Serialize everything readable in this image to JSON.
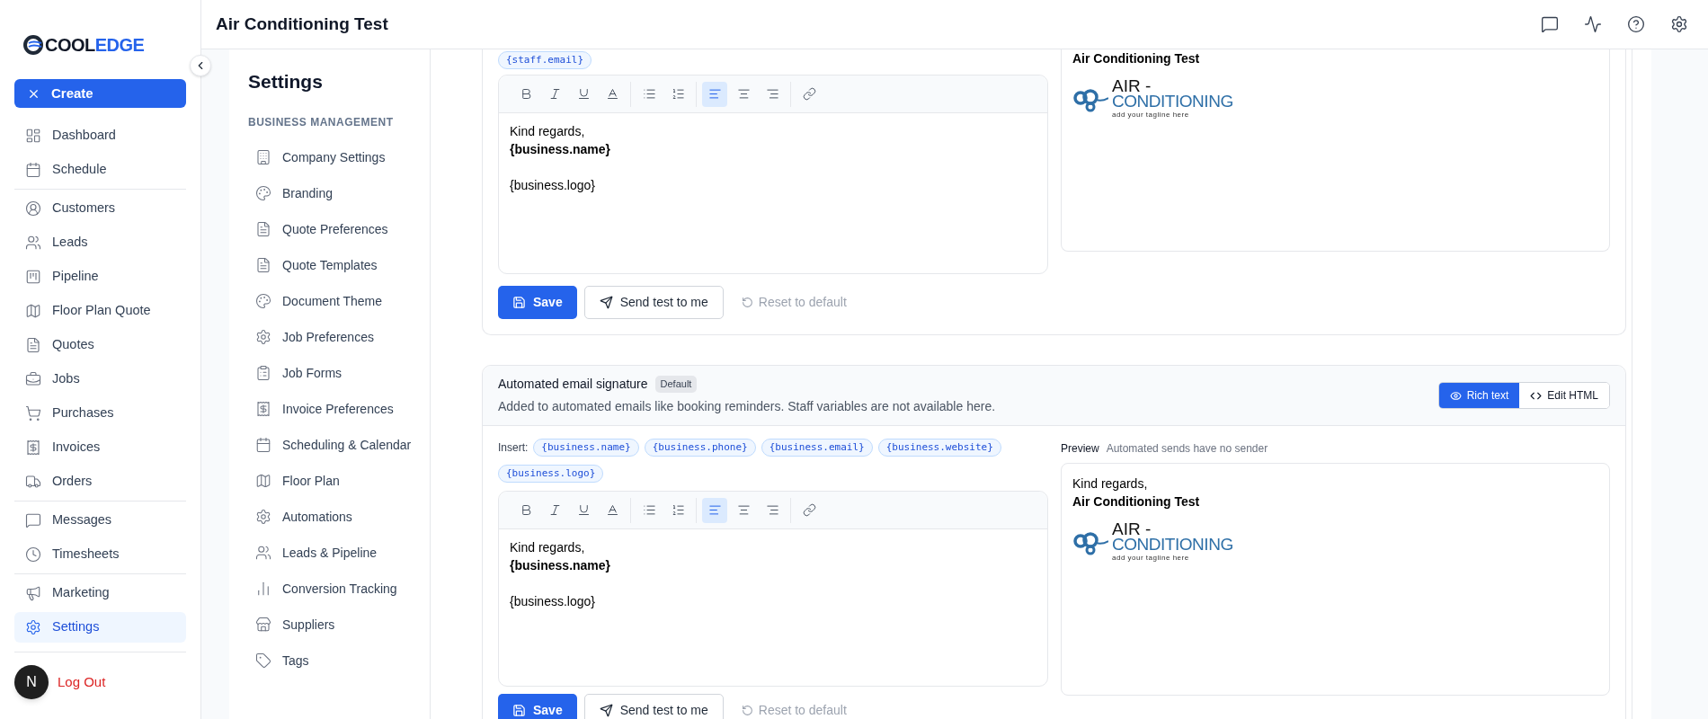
{
  "brand": {
    "part_a": "COOL",
    "part_b": "EDGE"
  },
  "sidebar": {
    "create": "Create",
    "groups": [
      [
        {
          "label": "Dashboard",
          "selected": false
        },
        {
          "label": "Schedule",
          "selected": false
        }
      ],
      [
        {
          "label": "Customers",
          "selected": false
        },
        {
          "label": "Leads",
          "selected": false
        },
        {
          "label": "Pipeline",
          "selected": false
        },
        {
          "label": "Floor Plan Quote",
          "selected": false
        },
        {
          "label": "Quotes",
          "selected": false
        },
        {
          "label": "Jobs",
          "selected": false
        },
        {
          "label": "Purchases",
          "selected": false
        },
        {
          "label": "Invoices",
          "selected": false
        },
        {
          "label": "Orders",
          "selected": false
        }
      ],
      [
        {
          "label": "Messages",
          "selected": false
        },
        {
          "label": "Timesheets",
          "selected": false
        }
      ],
      [
        {
          "label": "Marketing",
          "selected": false
        },
        {
          "label": "Settings",
          "selected": true
        }
      ]
    ],
    "logout": "Log Out",
    "avatar": "N"
  },
  "header": {
    "title": "Air Conditioning Test"
  },
  "settings_nav": {
    "title": "Settings",
    "section": "BUSINESS MANAGEMENT",
    "items": [
      {
        "label": "Company Settings"
      },
      {
        "label": "Branding"
      },
      {
        "label": "Quote Preferences"
      },
      {
        "label": "Quote Templates"
      },
      {
        "label": "Document Theme"
      },
      {
        "label": "Job Preferences"
      },
      {
        "label": "Job Forms"
      },
      {
        "label": "Invoice Preferences"
      },
      {
        "label": "Scheduling & Calendar"
      },
      {
        "label": "Floor Plan"
      },
      {
        "label": "Automations"
      },
      {
        "label": "Leads & Pipeline"
      },
      {
        "label": "Conversion Tracking"
      },
      {
        "label": "Suppliers"
      },
      {
        "label": "Tags"
      }
    ]
  },
  "cards": [
    {
      "chips": [
        "{staff.email}"
      ],
      "toolbar": [
        [
          {
            "kind": "bold",
            "selected": false
          },
          {
            "kind": "italic",
            "selected": false
          },
          {
            "kind": "underline",
            "selected": false
          },
          {
            "kind": "color",
            "selected": false
          }
        ],
        [
          {
            "kind": "bullets",
            "selected": false
          },
          {
            "kind": "numbers",
            "selected": false
          }
        ],
        [
          {
            "kind": "left",
            "selected": true
          },
          {
            "kind": "center",
            "selected": false
          },
          {
            "kind": "right",
            "selected": false
          }
        ],
        [
          {
            "kind": "link",
            "selected": false
          }
        ]
      ],
      "paragraphs": [
        [
          {
            "text": "Kind regards,",
            "bold": false
          },
          {
            "text": "{business.name}",
            "bold": true
          }
        ],
        [
          {
            "text": "{business.logo}",
            "bold": false
          }
        ]
      ],
      "preview": {
        "lines": [
          {
            "text": "Air Conditioning Test",
            "bold": true
          }
        ],
        "logo": {
          "line1": "AIR -",
          "line2": "CONDITIONING",
          "tagline": "add your tagline here"
        }
      },
      "buttons": {
        "save": "Save",
        "send": "Send test to me",
        "reset": "Reset to default",
        "reset_disabled": true
      }
    },
    {
      "title": "Automated email signature",
      "badge": "Default",
      "description": "Added to automated emails like booking reminders. Staff variables are not available here.",
      "modes": [
        {
          "label": "Rich text",
          "selected": true
        },
        {
          "label": "Edit HTML",
          "selected": false
        }
      ],
      "insert_label": "Insert:",
      "chips": [
        "{business.name}",
        "{business.phone}",
        "{business.email}",
        "{business.website}",
        "{business.logo}"
      ],
      "toolbar": [
        [
          {
            "kind": "bold",
            "selected": false
          },
          {
            "kind": "italic",
            "selected": false
          },
          {
            "kind": "underline",
            "selected": false
          },
          {
            "kind": "color",
            "selected": false
          }
        ],
        [
          {
            "kind": "bullets",
            "selected": false
          },
          {
            "kind": "numbers",
            "selected": false
          }
        ],
        [
          {
            "kind": "left",
            "selected": true
          },
          {
            "kind": "center",
            "selected": false
          },
          {
            "kind": "right",
            "selected": false
          }
        ],
        [
          {
            "kind": "link",
            "selected": false
          }
        ]
      ],
      "paragraphs": [
        [
          {
            "text": "Kind regards,",
            "bold": false
          },
          {
            "text": "{business.name}",
            "bold": true
          }
        ],
        [
          {
            "text": "{business.logo}",
            "bold": false
          }
        ]
      ],
      "preview": {
        "label": "Preview",
        "note": "Automated sends have no sender",
        "lines": [
          {
            "text": "Kind regards,",
            "bold": false
          },
          {
            "text": "Air Conditioning Test",
            "bold": true
          }
        ],
        "logo": {
          "line1": "AIR -",
          "line2": "CONDITIONING",
          "tagline": "add your tagline here"
        }
      },
      "buttons": {
        "save": "Save",
        "send": "Send test to me",
        "reset": "Reset to default",
        "reset_disabled": true
      }
    }
  ]
}
